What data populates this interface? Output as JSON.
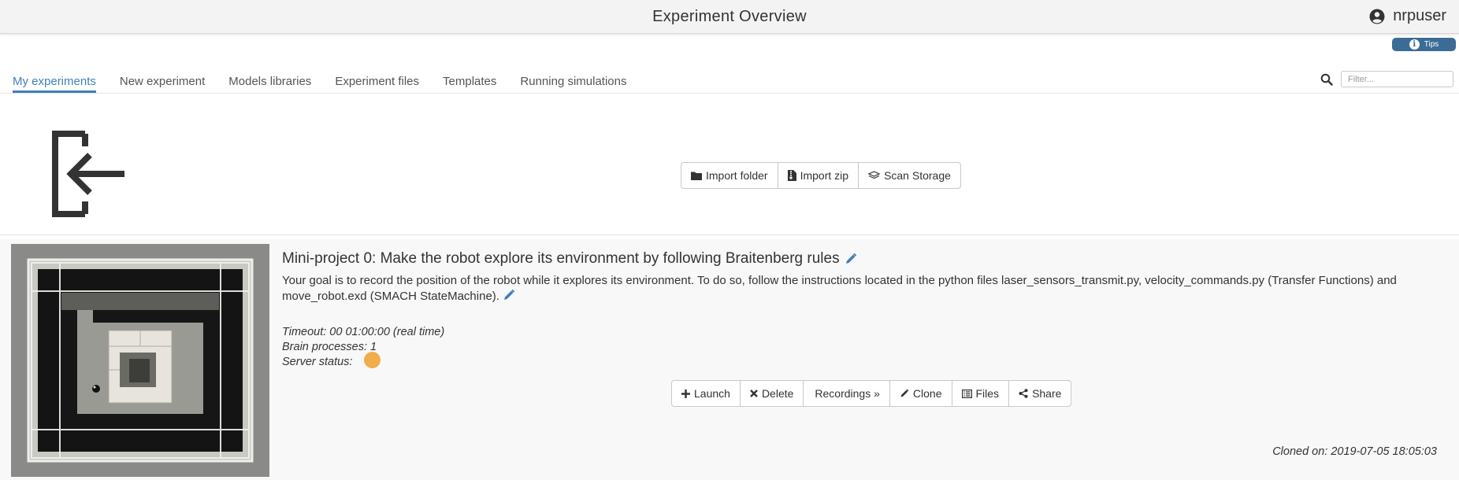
{
  "header": {
    "title": "Experiment Overview",
    "username": "nrpuser"
  },
  "tips": {
    "label": "Tips"
  },
  "tabs": [
    {
      "label": "My experiments",
      "active": true
    },
    {
      "label": "New experiment"
    },
    {
      "label": "Models libraries"
    },
    {
      "label": "Experiment files"
    },
    {
      "label": "Templates"
    },
    {
      "label": "Running simulations"
    }
  ],
  "filter": {
    "placeholder": "Filter...",
    "value": ""
  },
  "import_buttons": {
    "import_folder": "Import folder",
    "import_zip": "Import zip",
    "scan_storage": "Scan Storage"
  },
  "experiment": {
    "title": "Mini-project 0: Make the robot explore its environment by following Braitenberg rules",
    "description": "Your goal is to record the position of the robot while it explores its environment. To do so, follow the instructions located in the python files laser_sensors_transmit.py, velocity_commands.py (Transfer Functions) and move_robot.exd (SMACH StateMachine).",
    "timeout": "Timeout: 00 01:00:00 (real time)",
    "brain_processes": "Brain processes: 1",
    "server_status_label": "Server status:",
    "server_status_color": "#f0ad4e",
    "actions": {
      "launch": "Launch",
      "delete": "Delete",
      "recordings": "Recordings »",
      "clone": "Clone",
      "files": "Files",
      "share": "Share"
    },
    "cloned_on": "Cloned on: 2019-07-05 18:05:03"
  },
  "colors": {
    "accent": "#3f7fbf",
    "tips_bg": "#3a6c96"
  }
}
